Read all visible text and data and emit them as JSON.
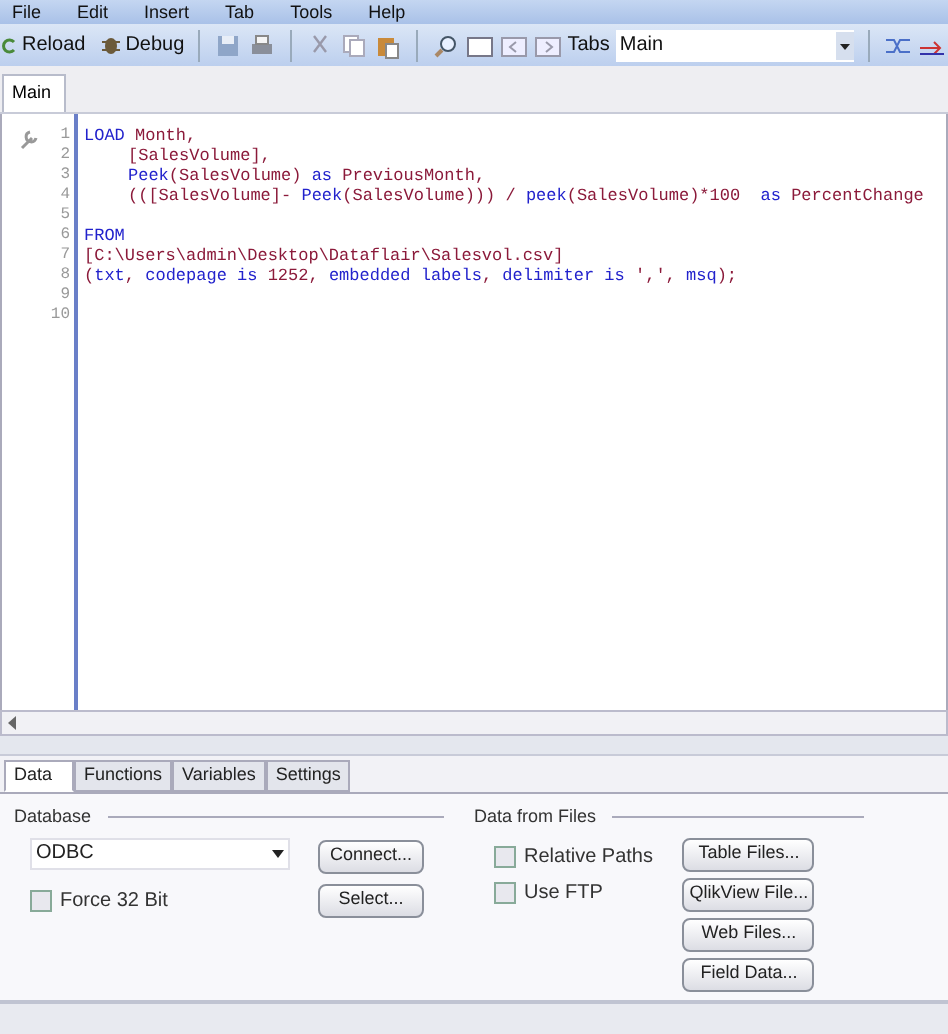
{
  "menu": [
    "File",
    "Edit",
    "Insert",
    "Tab",
    "Tools",
    "Help"
  ],
  "toolbar": {
    "reload": "Reload",
    "debug": "Debug",
    "tabs_label": "Tabs",
    "tabs_value": "Main"
  },
  "script_tabs": [
    {
      "label": "Main",
      "selected": true
    }
  ],
  "editor": {
    "lines": [
      {
        "number": "1",
        "tokens": [
          {
            "kind": "keyword",
            "text": "LOAD"
          },
          {
            "kind": "text",
            "text": " Month,"
          }
        ]
      },
      {
        "number": "2",
        "indented": true,
        "tokens": [
          {
            "kind": "text",
            "text": "[SalesVolume],"
          }
        ]
      },
      {
        "number": "3",
        "indented": true,
        "tokens": [
          {
            "kind": "keyword",
            "text": "Peek"
          },
          {
            "kind": "text",
            "text": "(SalesVolume) "
          },
          {
            "kind": "keyword",
            "text": "as"
          },
          {
            "kind": "text",
            "text": " PreviousMonth,"
          }
        ]
      },
      {
        "number": "4",
        "indented": true,
        "tokens": [
          {
            "kind": "text",
            "text": "(([SalesVolume]- "
          },
          {
            "kind": "keyword",
            "text": "Peek"
          },
          {
            "kind": "text",
            "text": "(SalesVolume))) / "
          },
          {
            "kind": "keyword",
            "text": "peek"
          },
          {
            "kind": "text",
            "text": "(SalesVolume)*100  "
          },
          {
            "kind": "keyword",
            "text": "as"
          },
          {
            "kind": "text",
            "text": " PercentChange"
          }
        ]
      },
      {
        "number": "5"
      },
      {
        "number": "6",
        "tokens": [
          {
            "kind": "keyword",
            "text": "FROM"
          }
        ]
      },
      {
        "number": "7",
        "tokens": [
          {
            "kind": "text",
            "text": "[C:\\Users\\admin\\Desktop\\Dataflair\\Salesvol.csv]"
          }
        ]
      },
      {
        "number": "8",
        "tokens": [
          {
            "kind": "text",
            "text": "("
          },
          {
            "kind": "keyword",
            "text": "txt"
          },
          {
            "kind": "text",
            "text": ", "
          },
          {
            "kind": "keyword",
            "text": "codepage is"
          },
          {
            "kind": "text",
            "text": " 1252, "
          },
          {
            "kind": "keyword",
            "text": "embedded labels"
          },
          {
            "kind": "text",
            "text": ", "
          },
          {
            "kind": "keyword",
            "text": "delimiter is"
          },
          {
            "kind": "text",
            "text": " ',', "
          },
          {
            "kind": "keyword",
            "text": "msq"
          },
          {
            "kind": "text",
            "text": ");"
          }
        ]
      },
      {
        "number": "9"
      },
      {
        "number": "10"
      }
    ]
  },
  "panel_tabs": [
    {
      "label": "Data",
      "selected": true
    },
    {
      "label": "Functions",
      "selected": false
    },
    {
      "label": "Variables",
      "selected": false
    },
    {
      "label": "Settings",
      "selected": false
    }
  ],
  "database": {
    "title": "Database",
    "driver": "ODBC",
    "force32": {
      "label": "Force 32 Bit",
      "checked": false
    },
    "buttons": [
      "Connect...",
      "Select..."
    ]
  },
  "files": {
    "title": "Data from Files",
    "options": [
      {
        "label": "Relative Paths",
        "checked": false
      },
      {
        "label": "Use FTP",
        "checked": false
      }
    ],
    "buttons": [
      "Table Files...",
      "QlikView File...",
      "Web Files...",
      "Field Data..."
    ]
  }
}
